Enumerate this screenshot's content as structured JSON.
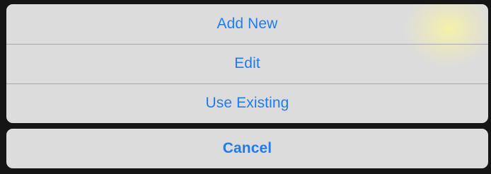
{
  "action_sheet": {
    "items": [
      {
        "label": "Add New"
      },
      {
        "label": "Edit"
      },
      {
        "label": "Use Existing"
      }
    ],
    "cancel_label": "Cancel"
  },
  "colors": {
    "action_text": "#1f7cf0",
    "sheet_background": "#dcdcdc",
    "backdrop": "#151515",
    "divider": "#a9a9a9"
  }
}
